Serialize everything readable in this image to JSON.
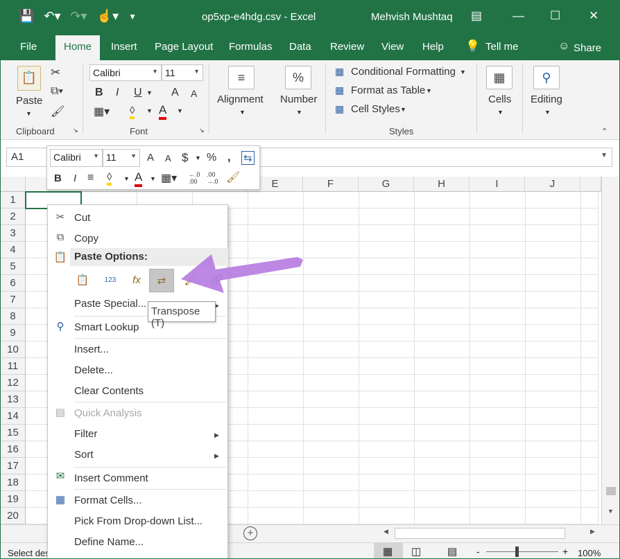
{
  "window": {
    "title": "op5xp-e4hdg.csv - Excel",
    "user": "Mehvish Mushtaq"
  },
  "tabs": [
    "File",
    "Home",
    "Insert",
    "Page Layout",
    "Formulas",
    "Data",
    "Review",
    "View",
    "Help",
    "Tell me",
    "Share"
  ],
  "ribbon": {
    "clipboard": {
      "paste_label": "Paste",
      "group_label": "Clipboard"
    },
    "font": {
      "font_name": "Calibri",
      "font_size": "11",
      "bold": "B",
      "italic": "I",
      "underline": "U",
      "grow": "A",
      "shrink": "A",
      "group_label": "Font"
    },
    "alignment": {
      "label": "Alignment"
    },
    "number": {
      "label": "Number",
      "icon_glyph": "%"
    },
    "styles": {
      "conditional": "Conditional Formatting",
      "table": "Format as Table",
      "cell_styles": "Cell Styles",
      "group_label": "Styles"
    },
    "cells": {
      "label": "Cells"
    },
    "editing": {
      "label": "Editing"
    }
  },
  "formula_bar": {
    "name_box": "A1",
    "value": ""
  },
  "mini_toolbar": {
    "font_name": "Calibri",
    "font_size": "11",
    "grow": "A",
    "shrink": "A",
    "currency": "$",
    "percent": "%",
    "comma": ",",
    "bold": "B",
    "italic": "I",
    "dec_increase": "←.0\n.00",
    "dec_decrease": ".00\n→.0"
  },
  "grid": {
    "columns": [
      "E",
      "F",
      "G",
      "H",
      "I",
      "J"
    ],
    "rows": [
      "1",
      "2",
      "3",
      "4",
      "5",
      "6",
      "7",
      "8",
      "9",
      "10",
      "11",
      "12",
      "13",
      "14",
      "15",
      "16",
      "17",
      "18",
      "19",
      "20"
    ]
  },
  "context_menu": {
    "cut": "Cut",
    "copy": "Copy",
    "paste_options": "Paste Options:",
    "paste_special": "Paste Special...",
    "smart_lookup": "Smart Lookup",
    "insert": "Insert...",
    "delete": "Delete...",
    "clear": "Clear Contents",
    "quick_analysis": "Quick Analysis",
    "filter": "Filter",
    "sort": "Sort",
    "insert_comment": "Insert Comment",
    "format_cells": "Format Cells...",
    "pick_dropdown": "Pick From Drop-down List...",
    "define_name": "Define Name...",
    "paste_123": "123",
    "paste_fx": "fx"
  },
  "tooltip": "Transpose (T)",
  "status": {
    "left": "Select des",
    "zoom": "100%",
    "zoom_minus": "-",
    "zoom_plus": "+"
  },
  "colors": {
    "excel_green": "#217346",
    "arrow": "#b57be0"
  }
}
